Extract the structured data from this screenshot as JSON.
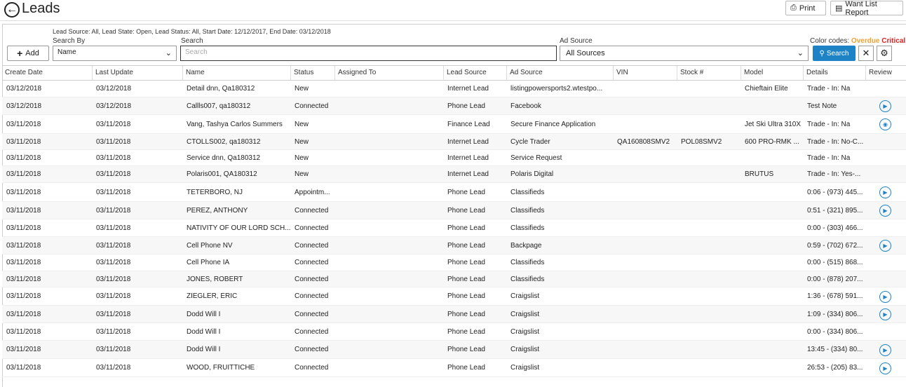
{
  "header": {
    "title": "Leads",
    "print_label": "Print",
    "wantlist_label": "Want List Report"
  },
  "filters": {
    "summary": "Lead Source: All,  Lead State: Open,  Lead Status: All,  Start Date: 12/12/2017,  End Date: 03/12/2018",
    "search_by_label": "Search By",
    "search_by_value": "Name",
    "search_label": "Search",
    "search_placeholder": "Search",
    "ad_source_label": "Ad Source",
    "ad_source_value": "All Sources",
    "color_codes_label": "Color codes:",
    "overdue_label": "Overdue",
    "critical_label": "Critical",
    "add_label": "Add",
    "search_button_label": "Search"
  },
  "colors": {
    "accent": "#1e83c6",
    "overdue": "#f0a030",
    "critical": "#e02020"
  },
  "table": {
    "columns": [
      "Create Date",
      "Last Update",
      "Name",
      "Status",
      "Assigned To",
      "Lead Source",
      "Ad Source",
      "VIN",
      "Stock #",
      "Model",
      "Details",
      "Review"
    ],
    "rows": [
      {
        "create": "03/12/2018",
        "update": "03/12/2018",
        "name": "Detail dnn, Qa180312",
        "status": "New",
        "assigned": "",
        "source": "Internet Lead",
        "ad": "listingpowersports2.wtestpo...",
        "vin": "",
        "stock": "",
        "model": "Chieftain Elite",
        "details": "Trade - In: Na",
        "review": ""
      },
      {
        "create": "03/12/2018",
        "update": "03/12/2018",
        "name": "Callls007, qa180312",
        "status": "Connected",
        "assigned": "",
        "source": "Phone Lead",
        "ad": "Facebook",
        "vin": "",
        "stock": "",
        "model": "",
        "details": "Test Note",
        "review": "play"
      },
      {
        "create": "03/11/2018",
        "update": "03/11/2018",
        "name": "Vang, Tashya Carlos Summers",
        "status": "New",
        "assigned": "",
        "source": "Finance Lead",
        "ad": "Secure Finance Application",
        "vin": "",
        "stock": "",
        "model": "Jet Ski Ultra 310X",
        "details": "Trade - In: Na",
        "review": "view"
      },
      {
        "create": "03/11/2018",
        "update": "03/11/2018",
        "name": "CTOLLS002, qa180312",
        "status": "New",
        "assigned": "",
        "source": "Internet Lead",
        "ad": "Cycle Trader",
        "vin": "QA160808SMV2",
        "stock": "POL08SMV2",
        "model": "600 PRO-RMK ...",
        "details": "Trade - In: No-C...",
        "review": ""
      },
      {
        "create": "03/11/2018",
        "update": "03/11/2018",
        "name": "Service dnn, Qa180312",
        "status": "New",
        "assigned": "",
        "source": "Internet Lead",
        "ad": "Service Request",
        "vin": "",
        "stock": "",
        "model": "",
        "details": "Trade - In: Na",
        "review": ""
      },
      {
        "create": "03/11/2018",
        "update": "03/11/2018",
        "name": "Polaris001, QA180312",
        "status": "New",
        "assigned": "",
        "source": "Internet Lead",
        "ad": "Polaris Digital",
        "vin": "",
        "stock": "",
        "model": "BRUTUS",
        "details": "Trade - In: Yes-...",
        "review": ""
      },
      {
        "create": "03/11/2018",
        "update": "03/11/2018",
        "name": "TETERBORO, NJ",
        "status": "Appointm...",
        "assigned": "",
        "source": "Phone Lead",
        "ad": "Classifieds",
        "vin": "",
        "stock": "",
        "model": "",
        "details": "0:06 - (973) 445...",
        "review": "play"
      },
      {
        "create": "03/11/2018",
        "update": "03/11/2018",
        "name": "PEREZ, ANTHONY",
        "status": "Connected",
        "assigned": "",
        "source": "Phone Lead",
        "ad": "Classifieds",
        "vin": "",
        "stock": "",
        "model": "",
        "details": "0:51 - (321) 895...",
        "review": "play"
      },
      {
        "create": "03/11/2018",
        "update": "03/11/2018",
        "name": "NATIVITY OF OUR LORD SCH...",
        "status": "Connected",
        "assigned": "",
        "source": "Phone Lead",
        "ad": "Classifieds",
        "vin": "",
        "stock": "",
        "model": "",
        "details": "0:00 - (303) 466...",
        "review": ""
      },
      {
        "create": "03/11/2018",
        "update": "03/11/2018",
        "name": "Cell Phone NV",
        "status": "Connected",
        "assigned": "",
        "source": "Phone Lead",
        "ad": "Backpage",
        "vin": "",
        "stock": "",
        "model": "",
        "details": "0:59 - (702) 672...",
        "review": "play"
      },
      {
        "create": "03/11/2018",
        "update": "03/11/2018",
        "name": "Cell Phone IA",
        "status": "Connected",
        "assigned": "",
        "source": "Phone Lead",
        "ad": "Classifieds",
        "vin": "",
        "stock": "",
        "model": "",
        "details": "0:00 - (515) 868...",
        "review": ""
      },
      {
        "create": "03/11/2018",
        "update": "03/11/2018",
        "name": "JONES, ROBERT",
        "status": "Connected",
        "assigned": "",
        "source": "Phone Lead",
        "ad": "Classifieds",
        "vin": "",
        "stock": "",
        "model": "",
        "details": "0:00 - (878) 207...",
        "review": ""
      },
      {
        "create": "03/11/2018",
        "update": "03/11/2018",
        "name": "ZIEGLER, ERIC",
        "status": "Connected",
        "assigned": "",
        "source": "Phone Lead",
        "ad": "Craigslist",
        "vin": "",
        "stock": "",
        "model": "",
        "details": "1:36 - (678) 591...",
        "review": "play"
      },
      {
        "create": "03/11/2018",
        "update": "03/11/2018",
        "name": "Dodd Will I",
        "status": "Connected",
        "assigned": "",
        "source": "Phone Lead",
        "ad": "Craigslist",
        "vin": "",
        "stock": "",
        "model": "",
        "details": "1:09 - (334) 806...",
        "review": "play"
      },
      {
        "create": "03/11/2018",
        "update": "03/11/2018",
        "name": "Dodd Will I",
        "status": "Connected",
        "assigned": "",
        "source": "Phone Lead",
        "ad": "Craigslist",
        "vin": "",
        "stock": "",
        "model": "",
        "details": "0:00 - (334) 806...",
        "review": ""
      },
      {
        "create": "03/11/2018",
        "update": "03/11/2018",
        "name": "Dodd Will I",
        "status": "Connected",
        "assigned": "",
        "source": "Phone Lead",
        "ad": "Craigslist",
        "vin": "",
        "stock": "",
        "model": "",
        "details": "13:45 - (334) 80...",
        "review": "play"
      },
      {
        "create": "03/11/2018",
        "update": "03/11/2018",
        "name": "WOOD, FRUITTICHE",
        "status": "Connected",
        "assigned": "",
        "source": "Phone Lead",
        "ad": "Craigslist",
        "vin": "",
        "stock": "",
        "model": "",
        "details": "26:53 - (205) 83...",
        "review": "play"
      }
    ]
  }
}
